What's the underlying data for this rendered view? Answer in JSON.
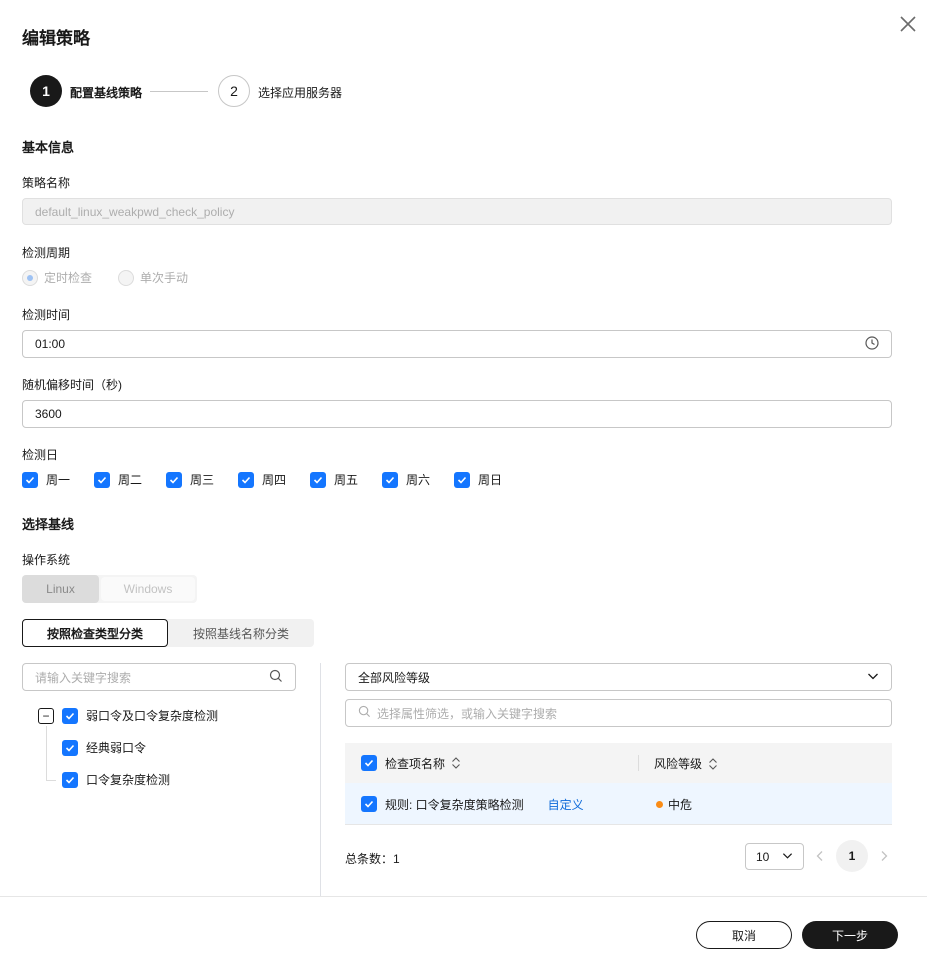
{
  "dialog": {
    "title": "编辑策略",
    "close_icon": "close-icon"
  },
  "steps": [
    {
      "number": "1",
      "label": "配置基线策略"
    },
    {
      "number": "2",
      "label": "选择应用服务器"
    }
  ],
  "basic_info": {
    "section_title": "基本信息",
    "policy_name_label": "策略名称",
    "policy_name_value": "default_linux_weakpwd_check_policy",
    "cycle_label": "检测周期",
    "cycle_options": [
      "定时检查",
      "单次手动"
    ],
    "time_label": "检测时间",
    "time_value": "01:00",
    "offset_label": "随机偏移时间（秒)",
    "offset_value": "3600",
    "days_label": "检测日",
    "days": [
      "周一",
      "周二",
      "周三",
      "周四",
      "周五",
      "周六",
      "周日"
    ]
  },
  "baseline": {
    "section_title": "选择基线",
    "os_label": "操作系统",
    "os_options": [
      "Linux",
      "Windows"
    ],
    "tabs": [
      "按照检查类型分类",
      "按照基线名称分类"
    ],
    "tree_search_placeholder": "请输入关键字搜索",
    "tree": {
      "root": "弱口令及口令复杂度检测",
      "children": [
        "经典弱口令",
        "口令复杂度检测"
      ]
    },
    "risk_select": "全部风险等级",
    "filter_placeholder": "选择属性筛选，或输入关键字搜索",
    "table": {
      "columns": [
        "检查项名称",
        "风险等级"
      ],
      "rows": [
        {
          "name": "规则: 口令复杂度策略检测",
          "tag": "自定义",
          "risk": "中危"
        }
      ]
    },
    "total": "总条数：1",
    "page_size": "10",
    "current_page": "1"
  },
  "footer": {
    "cancel": "取消",
    "next": "下一步"
  },
  "colors": {
    "primary": "#191919",
    "checkbox": "#1476ff",
    "medium_risk": "#fa8c16",
    "link": "#0d6ad9"
  }
}
